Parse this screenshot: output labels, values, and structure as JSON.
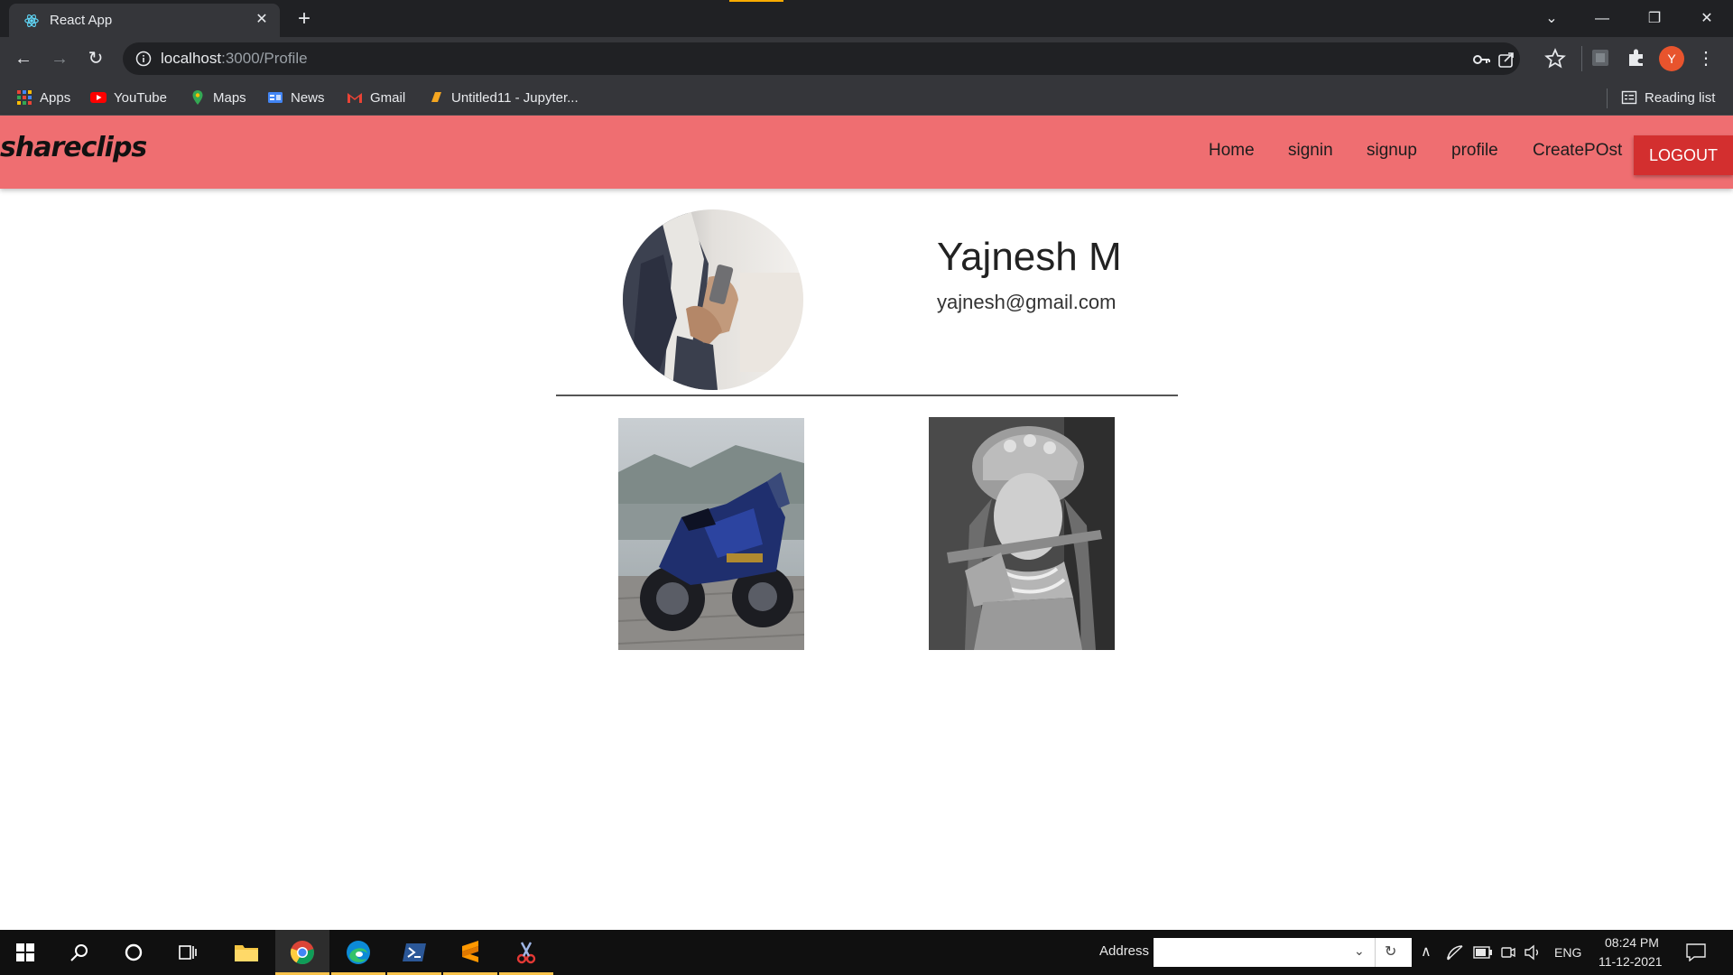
{
  "browser": {
    "tab": {
      "title": "React App",
      "favicon": "react-icon"
    },
    "url": {
      "host": "localhost",
      "path": ":3000/Profile"
    },
    "bookmarks": [
      {
        "label": "Apps",
        "icon": "apps-grid-icon"
      },
      {
        "label": "YouTube",
        "icon": "youtube-icon"
      },
      {
        "label": "Maps",
        "icon": "maps-icon"
      },
      {
        "label": "News",
        "icon": "news-icon"
      },
      {
        "label": "Gmail",
        "icon": "gmail-icon"
      },
      {
        "label": "Untitled11 - Jupyter...",
        "icon": "jupyter-icon"
      }
    ],
    "reading_list": "Reading list",
    "profile_initial": "Y"
  },
  "app": {
    "brand": "shareclips",
    "nav": {
      "home": "Home",
      "signin": "signin",
      "signup": "signup",
      "profile": "profile",
      "createpost": "CreatePOst",
      "logout": "LOGOUT"
    },
    "colors": {
      "navbar": "#ef6e71",
      "logout": "#d32f2f"
    }
  },
  "profile": {
    "name": "Yajnesh M",
    "email": "yajnesh@gmail.com",
    "avatar": "person-with-phone-photo"
  },
  "gallery": [
    {
      "subject": "blue-sport-motorcycle-photo"
    },
    {
      "subject": "krishna-with-flute-portrait"
    }
  ],
  "taskbar": {
    "address_label": "Address",
    "language": "ENG",
    "time": "08:24 PM",
    "date": "11-12-2021"
  }
}
